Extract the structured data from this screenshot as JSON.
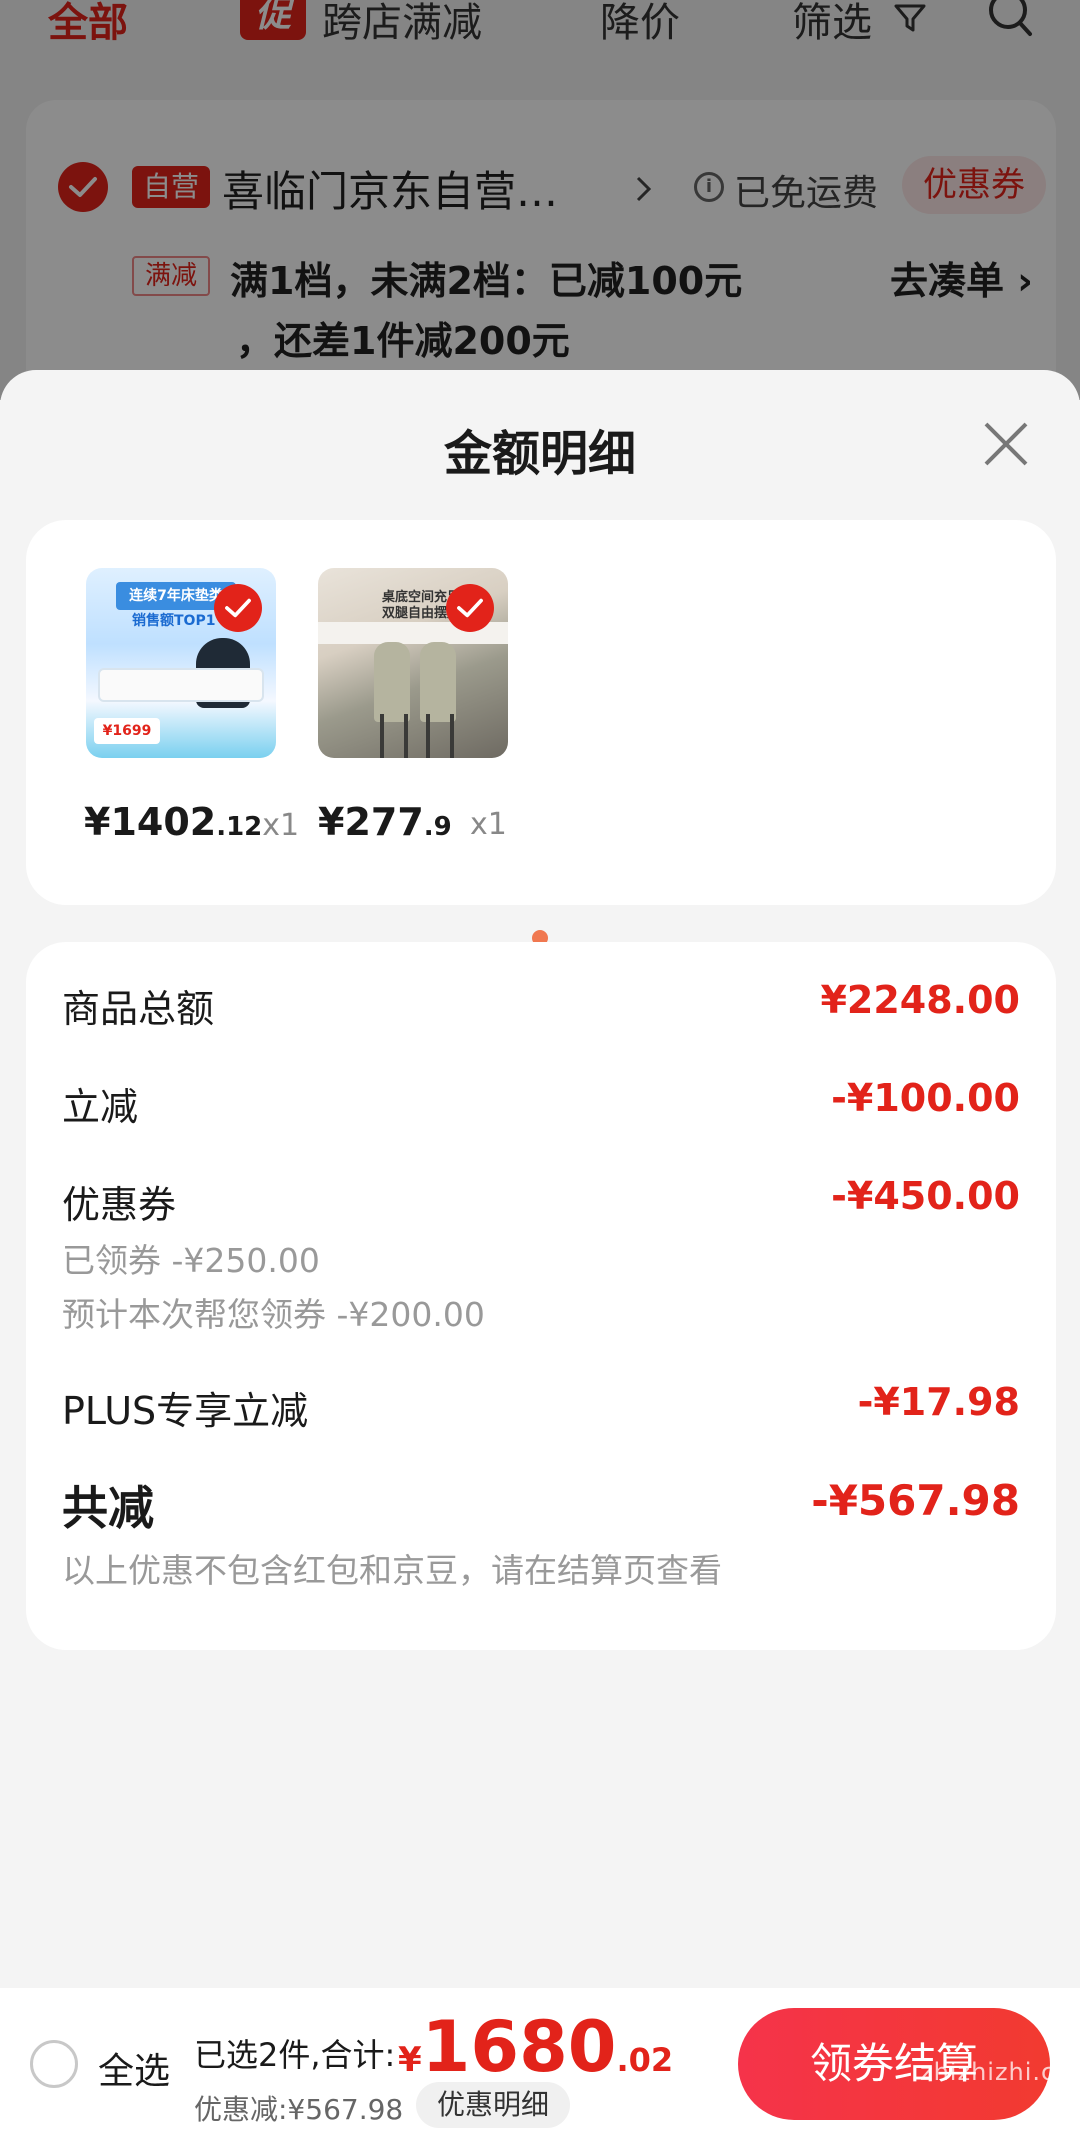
{
  "top_nav": {
    "all": "全部",
    "promo_badge": "促",
    "promo": "跨店满减",
    "price_drop": "降价",
    "filter": "筛选"
  },
  "store": {
    "self_tag": "自营",
    "name": "喜临门京东自营…",
    "free_shipping": "已免运费",
    "coupon": "优惠券",
    "promo_tag": "满减",
    "promo_line1": "满1档，未满2档：已减100元",
    "promo_line2": "，还差1件减200元",
    "go_add": "去凑单 ›"
  },
  "sheet": {
    "title": "金额明细"
  },
  "products": [
    {
      "price_int": "¥1402",
      "price_dec": ".12",
      "qty": "x1",
      "image_text_1": "连续7年床垫类",
      "image_text_2": "销售额TOP1",
      "image_price": "¥1699"
    },
    {
      "price_int": "¥277",
      "price_dec": ".9",
      "qty": "x1",
      "image_text_1": "桌底空间充足",
      "image_text_2": "双腿自由摆放"
    }
  ],
  "detail": {
    "goods_total_label": "商品总额",
    "goods_total_value": "¥2248.00",
    "instant_label": "立减",
    "instant_value": "-¥100.00",
    "coupon_label": "优惠券",
    "coupon_value": "-¥450.00",
    "coupon_sub1": "已领券 -¥250.00",
    "coupon_sub2": "预计本次帮您领券 -¥200.00",
    "plus_label": "PLUS专享立减",
    "plus_value": "-¥17.98",
    "total_label": "共减",
    "total_value": "-¥567.98",
    "note": "以上优惠不包含红包和京豆，请在结算页查看"
  },
  "bottom": {
    "select_all": "全选",
    "selected_info": "已选2件,合计:",
    "currency": "¥",
    "total_int": "1680",
    "total_dec": ".02",
    "discount": "优惠减:¥567.98",
    "detail_button": "优惠明细",
    "checkout_button": "领券结算",
    "watermark": "zhizhizhi.com"
  },
  "colors": {
    "accent_red": "#e2231a",
    "checkout_gradient_start": "#f5334a",
    "dot": "#f07850"
  }
}
